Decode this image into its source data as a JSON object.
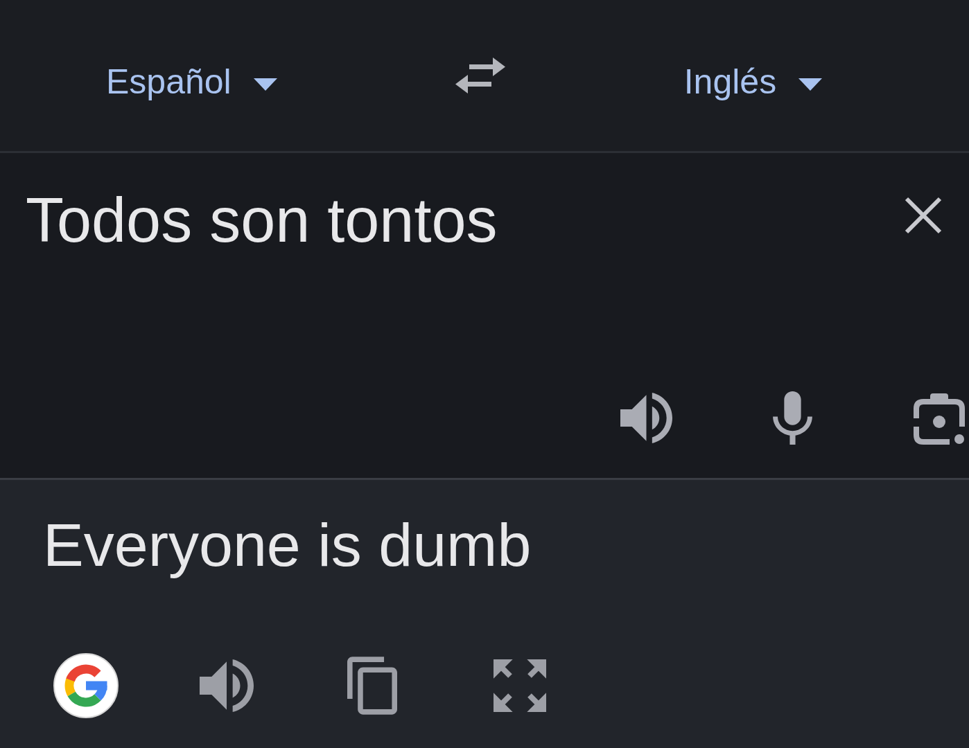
{
  "language_bar": {
    "source_language": "Español",
    "target_language": "Inglés"
  },
  "source": {
    "text": "Todos son tontos"
  },
  "translation": {
    "text": "Everyone is dumb"
  }
}
